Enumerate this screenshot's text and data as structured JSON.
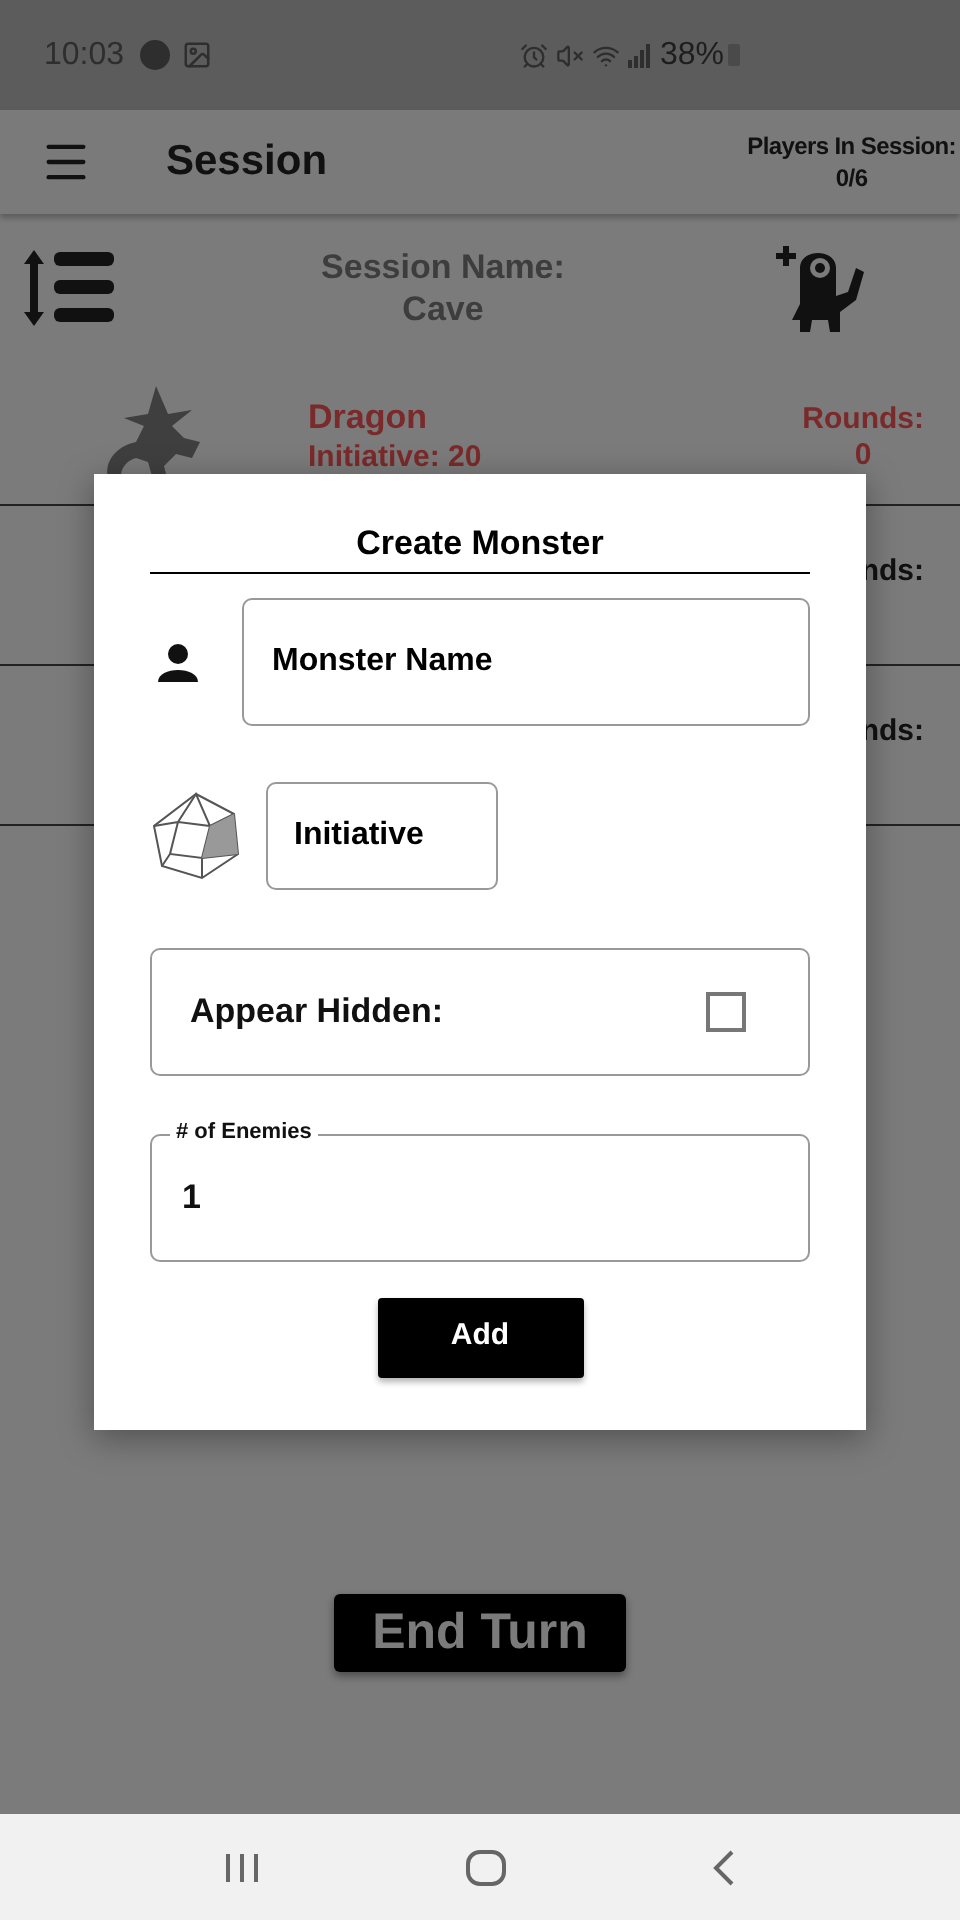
{
  "status_bar": {
    "time": "10:03",
    "battery": "38%"
  },
  "app_bar": {
    "title": "Session",
    "players_label": "Players In Session:",
    "players_count": "0/6"
  },
  "session": {
    "name_label": "Session Name:",
    "name": "Cave"
  },
  "combatants": [
    {
      "kind": "full",
      "name": "Dragon",
      "initiative": "Initiative: 20",
      "rounds_label": "Rounds:",
      "rounds": "0"
    },
    {
      "kind": "partial",
      "rounds_label": "nds:"
    },
    {
      "kind": "partial",
      "rounds_label": "nds:"
    }
  ],
  "dialog": {
    "title": "Create Monster",
    "name_field": {
      "placeholder": "Monster Name"
    },
    "initiative_field": {
      "placeholder": "Initiative"
    },
    "appear_hidden": {
      "label": "Appear Hidden:",
      "checked": false
    },
    "enemies_field": {
      "label": "# of Enemies",
      "value": "1"
    },
    "add_button": "Add"
  },
  "end_turn_button": "End Turn"
}
